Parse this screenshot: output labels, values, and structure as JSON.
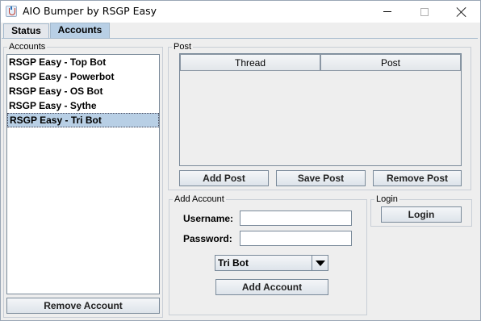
{
  "window": {
    "title": "AIO Bumper by RSGP Easy"
  },
  "tabs": [
    {
      "label": "Status"
    },
    {
      "label": "Accounts"
    }
  ],
  "accounts_panel": {
    "title": "Accounts",
    "items": [
      {
        "label": "RSGP Easy - Top Bot"
      },
      {
        "label": "RSGP Easy - Powerbot"
      },
      {
        "label": "RSGP Easy - OS Bot"
      },
      {
        "label": "RSGP Easy - Sythe"
      },
      {
        "label": "RSGP Easy - Tri Bot"
      }
    ],
    "selected_index": 4,
    "remove_label": "Remove Account"
  },
  "post_panel": {
    "title": "Post",
    "columns": [
      "Thread",
      "Post"
    ],
    "add_label": "Add Post",
    "save_label": "Save Post",
    "remove_label": "Remove Post"
  },
  "add_account_panel": {
    "title": "Add Account",
    "username_label": "Username:",
    "password_label": "Password:",
    "username_value": "",
    "password_value": "",
    "bot_select_value": "Tri Bot",
    "add_label": "Add Account"
  },
  "login_panel": {
    "title": "Login",
    "login_label": "Login"
  },
  "colors": {
    "selection": "#b8cfe5",
    "panel_bg": "#eeeeee"
  }
}
